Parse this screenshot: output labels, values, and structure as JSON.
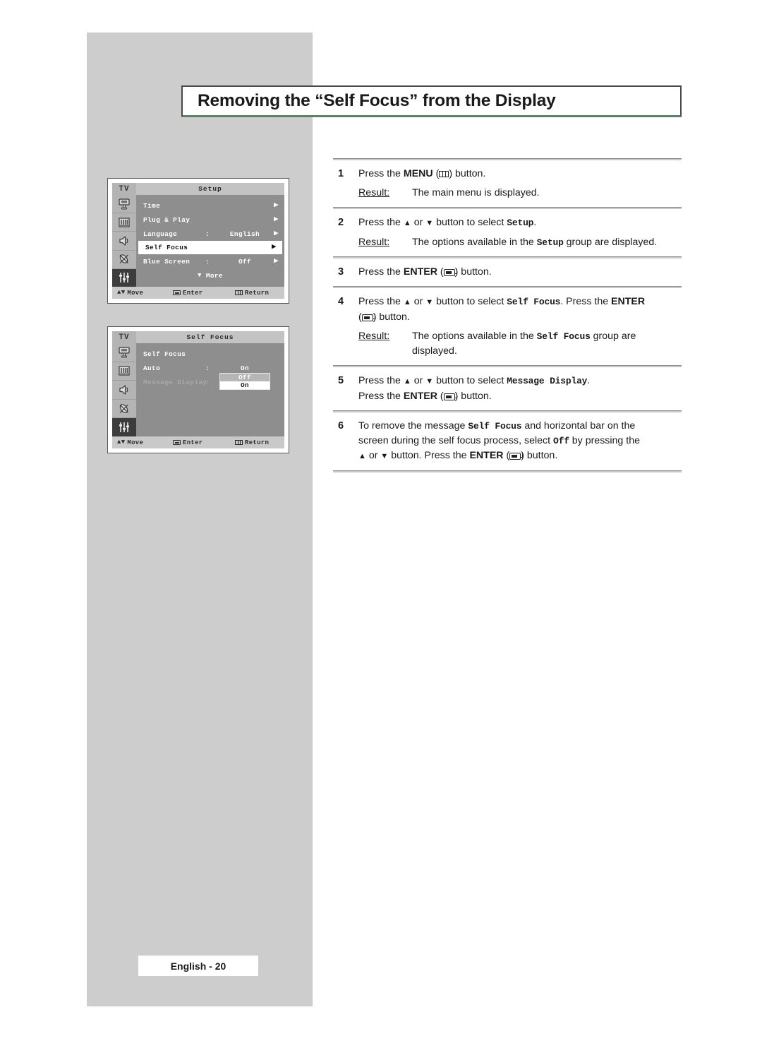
{
  "page": {
    "title": "Removing the “Self Focus” from the Display",
    "footer_badge": "English - 20"
  },
  "menu_panel_1": {
    "logo": "TV",
    "title": "Setup",
    "sidebar_icons": [
      "picture-tube-icon",
      "bars-icon",
      "speaker-icon",
      "satellite-dish-icon",
      "sliders-icon"
    ],
    "rows": [
      {
        "label": "Time",
        "colon": "",
        "value": "",
        "arrow": "▶",
        "state": "normal"
      },
      {
        "label": "Plug & Play",
        "colon": "",
        "value": "",
        "arrow": "▶",
        "state": "normal"
      },
      {
        "label": "Language",
        "colon": ":",
        "value": "English",
        "arrow": "▶",
        "state": "normal"
      },
      {
        "label": "Self Focus",
        "colon": "",
        "value": "",
        "arrow": "▶",
        "state": "highlight"
      },
      {
        "label": "Blue Screen",
        "colon": ":",
        "value": "Off",
        "arrow": "▶",
        "state": "normal"
      }
    ],
    "more_label": "More",
    "footbar": {
      "move": "Move",
      "enter": "Enter",
      "return": "Return"
    }
  },
  "menu_panel_2": {
    "logo": "TV",
    "title": "Self Focus",
    "sidebar_icons": [
      "picture-tube-icon",
      "bars-icon",
      "speaker-icon",
      "satellite-dish-icon",
      "sliders-icon"
    ],
    "rows": [
      {
        "label": "Self Focus",
        "colon": "",
        "value": "",
        "state": "normal"
      },
      {
        "label": "Auto",
        "colon": ":",
        "value": "On",
        "state": "normal"
      },
      {
        "label": "Message Display",
        "colon": ":",
        "value": "",
        "state": "dim"
      }
    ],
    "dropdown": {
      "options": [
        "Off",
        "On"
      ],
      "selected": "On"
    },
    "footbar": {
      "move": "Move",
      "enter": "Enter",
      "return": "Return"
    }
  },
  "steps": [
    {
      "num": "1",
      "lines": [
        [
          {
            "t": "Press the "
          },
          {
            "t": "MENU",
            "s": "bold"
          },
          {
            "t": " ("
          },
          {
            "t": "",
            "s": "menu-glyph"
          },
          {
            "t": ")  button."
          }
        ]
      ],
      "result": {
        "label": "Result:",
        "lines": [
          [
            {
              "t": "The main menu is displayed."
            }
          ]
        ]
      }
    },
    {
      "num": "2",
      "lines": [
        [
          {
            "t": "Press the "
          },
          {
            "t": "▲",
            "s": "tri"
          },
          {
            "t": " or "
          },
          {
            "t": "▼",
            "s": "tri"
          },
          {
            "t": " button to select "
          },
          {
            "t": "Setup",
            "s": "mono"
          },
          {
            "t": "."
          }
        ]
      ],
      "result": {
        "label": "Result:",
        "lines": [
          [
            {
              "t": "The options available in the "
            },
            {
              "t": "Setup",
              "s": "mono"
            },
            {
              "t": " group are displayed."
            }
          ]
        ]
      }
    },
    {
      "num": "3",
      "lines": [
        [
          {
            "t": "Press the "
          },
          {
            "t": "ENTER",
            "s": "bold"
          },
          {
            "t": " ("
          },
          {
            "t": "",
            "s": "enter-glyph"
          },
          {
            "t": ") button."
          }
        ]
      ],
      "result": null
    },
    {
      "num": "4",
      "lines": [
        [
          {
            "t": "Press the "
          },
          {
            "t": "▲",
            "s": "tri"
          },
          {
            "t": " or "
          },
          {
            "t": "▼",
            "s": "tri"
          },
          {
            "t": " button to select "
          },
          {
            "t": "Self Focus",
            "s": "mono"
          },
          {
            "t": ". Press the "
          },
          {
            "t": "ENTER",
            "s": "bold"
          }
        ],
        [
          {
            "t": "("
          },
          {
            "t": "",
            "s": "enter-glyph"
          },
          {
            "t": ") button."
          }
        ]
      ],
      "result": {
        "label": "Result:",
        "lines": [
          [
            {
              "t": "The options available in the "
            },
            {
              "t": "Self Focus",
              "s": "mono"
            },
            {
              "t": " group are"
            }
          ],
          [
            {
              "t": "displayed."
            }
          ]
        ]
      }
    },
    {
      "num": "5",
      "lines": [
        [
          {
            "t": "Press the "
          },
          {
            "t": "▲",
            "s": "tri"
          },
          {
            "t": " or "
          },
          {
            "t": "▼",
            "s": "tri"
          },
          {
            "t": " button to select "
          },
          {
            "t": "Message Display",
            "s": "mono"
          },
          {
            "t": "."
          }
        ],
        [
          {
            "t": "Press the "
          },
          {
            "t": "ENTER",
            "s": "bold"
          },
          {
            "t": " ("
          },
          {
            "t": "",
            "s": "enter-glyph"
          },
          {
            "t": ") button."
          }
        ]
      ],
      "result": null
    },
    {
      "num": "6",
      "lines": [
        [
          {
            "t": "To remove the message "
          },
          {
            "t": "Self Focus",
            "s": "mono"
          },
          {
            "t": " and horizontal bar on the"
          }
        ],
        [
          {
            "t": "screen during the self focus process, select "
          },
          {
            "t": "Off",
            "s": "mono"
          },
          {
            "t": " by pressing the"
          }
        ],
        [
          {
            "t": "▲",
            "s": "tri"
          },
          {
            "t": " or "
          },
          {
            "t": "▼",
            "s": "tri"
          },
          {
            "t": " button. Press the "
          },
          {
            "t": "ENTER",
            "s": "bold"
          },
          {
            "t": " ("
          },
          {
            "t": "",
            "s": "enter-glyph"
          },
          {
            "t": ") button."
          }
        ]
      ],
      "result": null
    }
  ]
}
